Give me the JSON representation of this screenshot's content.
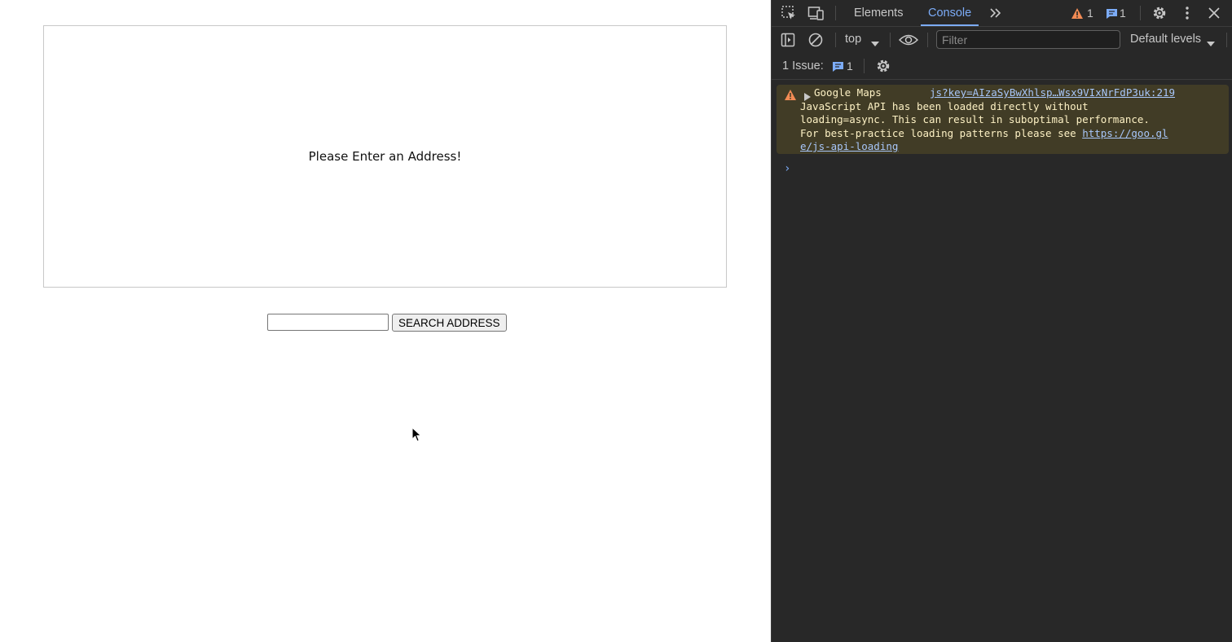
{
  "page": {
    "map_message": "Please Enter an Address!",
    "address_input": {
      "value": "",
      "placeholder": ""
    },
    "search_button_label": "SEARCH ADDRESS"
  },
  "devtools": {
    "tabs": [
      {
        "label": "Elements",
        "active": false
      },
      {
        "label": "Console",
        "active": true
      }
    ],
    "warning_count": "1",
    "message_count": "1",
    "toolbar": {
      "context": "top",
      "filter_placeholder": "Filter",
      "levels": "Default levels"
    },
    "issues": {
      "label": "1 Issue:",
      "count": "1"
    },
    "console_messages": [
      {
        "level": "warning",
        "title": "Google Maps",
        "source": "js?key=AIzaSyBwXhlsp…Wsx9VIxNrFdP3uk:219",
        "line2": "JavaScript API has been loaded directly without",
        "line3": "loading=async. This can result in suboptimal performance.",
        "line4_prefix": "For best-practice loading patterns please see ",
        "link_part1": "https://goo.gl",
        "link_part2": "e/js-api-loading"
      }
    ],
    "prompt_symbol": "›"
  },
  "colors": {
    "devtools_bg": "#282828",
    "accent": "#7cacf8",
    "warning_bg": "#413c26",
    "warning_icon": "#f28b54",
    "warning_text": "#fdf1c4",
    "link": "#a8c7fa"
  },
  "icons": [
    "select-element-icon",
    "device-toggle-icon",
    "more-tabs-icon",
    "warning-icon",
    "message-icon",
    "settings-icon",
    "kebab-menu-icon",
    "close-icon",
    "sidebar-toggle-icon",
    "clear-console-icon",
    "dropdown-arrow-icon",
    "eye-icon",
    "gear-icon",
    "expand-triangle-icon",
    "cursor-icon"
  ]
}
